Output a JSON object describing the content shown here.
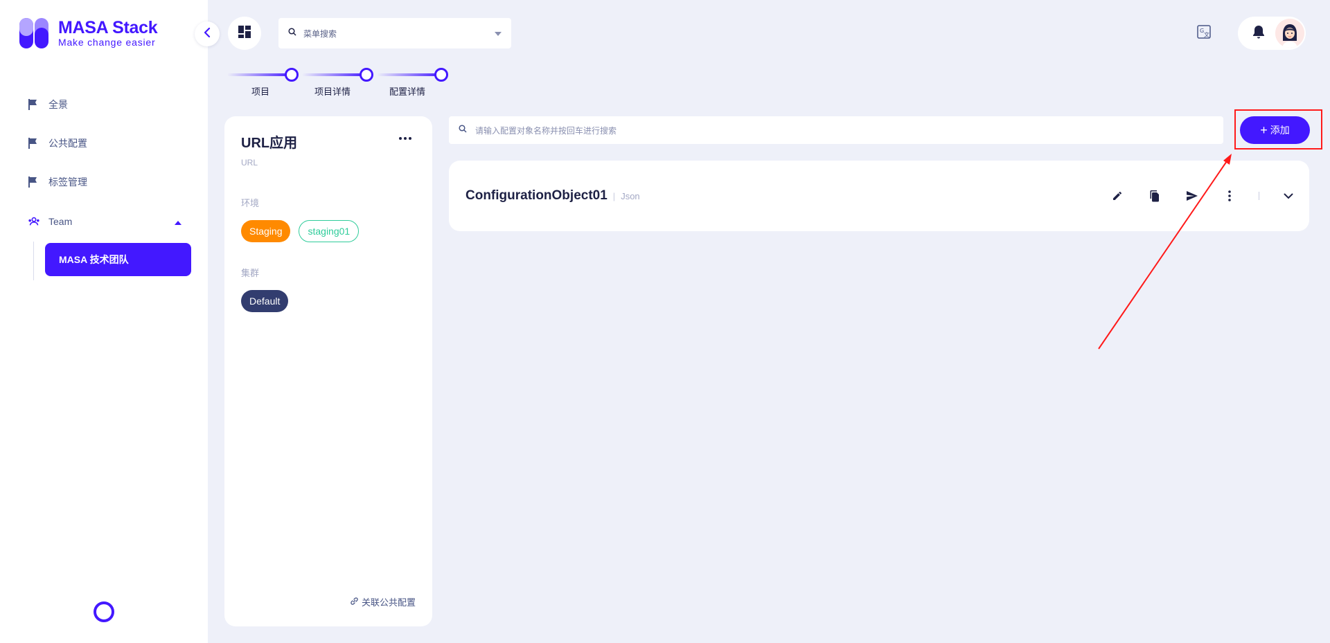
{
  "brand": {
    "title": "MASA Stack",
    "subtitle": "Make change easier",
    "color": "#4318ff"
  },
  "sidebar": {
    "items": [
      {
        "label": "全景",
        "icon": "flag-icon"
      },
      {
        "label": "公共配置",
        "icon": "flag-icon"
      },
      {
        "label": "标签管理",
        "icon": "flag-icon"
      }
    ],
    "team": {
      "label": "Team",
      "icon": "team-icon",
      "expanded": true
    },
    "team_sub_items": [
      {
        "label": "MASA 技术团队",
        "active": true
      }
    ]
  },
  "topbar": {
    "menu_search_placeholder": "菜单搜索",
    "icons": [
      "dashboard-icon",
      "translate-icon",
      "bell-icon",
      "avatar"
    ]
  },
  "breadcrumb": [
    {
      "label": "项目"
    },
    {
      "label": "项目详情"
    },
    {
      "label": "配置详情"
    }
  ],
  "app": {
    "title": "URL应用",
    "subtitle": "URL",
    "env_label": "环境",
    "envs": [
      {
        "label": "Staging",
        "color": "#ff8a00",
        "selected": true
      },
      {
        "label": "staging01",
        "color": "#2ecc9a",
        "selected": false
      }
    ],
    "cluster_label": "集群",
    "clusters": [
      {
        "label": "Default",
        "color": "#323d6f",
        "selected": true
      }
    ],
    "link_public_config": "关联公共配置"
  },
  "config": {
    "search_placeholder": "请输入配置对象名称并按回车进行搜索",
    "add_label": "添加",
    "objects": [
      {
        "name": "ConfigurationObject01",
        "separator": "|",
        "format": "Json",
        "actions": [
          "edit-icon",
          "copy-icon",
          "publish-icon",
          "more-vert-icon",
          "chevron-down-icon"
        ]
      }
    ]
  },
  "annotation": {
    "color": "#ff1a1a"
  }
}
